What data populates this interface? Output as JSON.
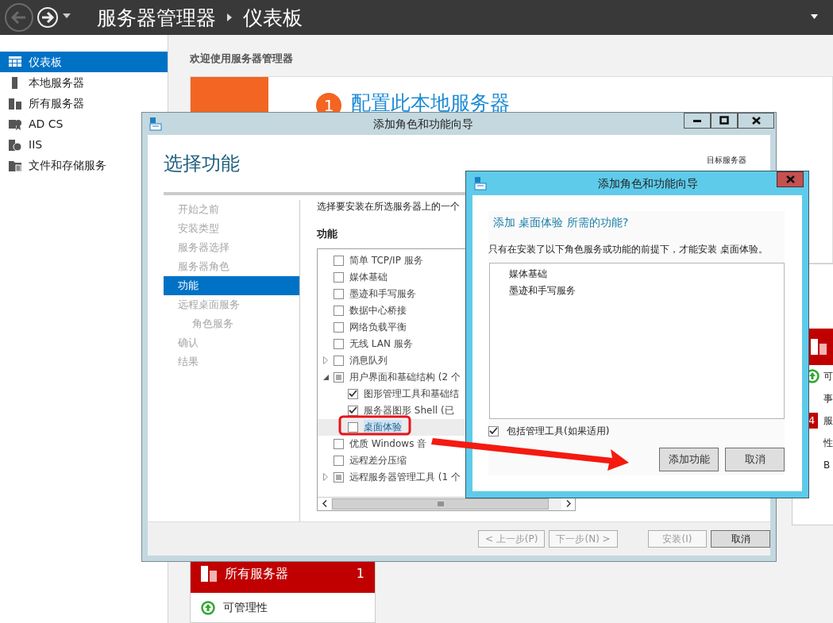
{
  "app": {
    "title": "服务器管理器",
    "page": "仪表板"
  },
  "sidebar": {
    "items": [
      {
        "label": "仪表板",
        "selected": true
      },
      {
        "label": "本地服务器",
        "selected": false
      },
      {
        "label": "所有服务器",
        "selected": false
      },
      {
        "label": "AD CS",
        "selected": false
      },
      {
        "label": "IIS",
        "selected": false
      },
      {
        "label": "文件和存储服务",
        "selected": false
      }
    ]
  },
  "dashboard": {
    "welcome": "欢迎使用服务器管理器",
    "quick_start": {
      "step": "1",
      "link": "配置此本地服务器"
    },
    "tile_main": {
      "title": "所有服务器",
      "count": "1",
      "rows": [
        {
          "label": "可管理性",
          "kind": "status"
        }
      ]
    },
    "tile_side": {
      "rows": [
        {
          "label": "可",
          "kind": "status"
        },
        {
          "label": "事",
          "kind": "plain"
        },
        {
          "label": "服",
          "kind": "badge",
          "badge": "4"
        },
        {
          "label": "性",
          "kind": "plain"
        },
        {
          "label": "B",
          "kind": "plain"
        }
      ]
    }
  },
  "wizard": {
    "title": "添加角色和功能向导",
    "heading": "选择功能",
    "target_label": "目标服务器",
    "steps": [
      {
        "label": "开始之前",
        "selected": false
      },
      {
        "label": "安装类型",
        "selected": false
      },
      {
        "label": "服务器选择",
        "selected": false
      },
      {
        "label": "服务器角色",
        "selected": false
      },
      {
        "label": "功能",
        "selected": true
      },
      {
        "label": "远程桌面服务",
        "selected": false,
        "children": [
          {
            "label": "角色服务",
            "selected": false
          }
        ]
      },
      {
        "label": "确认",
        "selected": false
      },
      {
        "label": "结果",
        "selected": false
      }
    ],
    "intro": "选择要安装在所选服务器上的一个",
    "features_label": "功能",
    "features": [
      {
        "label": "简单 TCP/IP 服务",
        "checked": false,
        "partial": false,
        "selected": false
      },
      {
        "label": "媒体基础",
        "checked": false,
        "partial": false,
        "selected": false
      },
      {
        "label": "墨迹和手写服务",
        "checked": false,
        "partial": false,
        "selected": false
      },
      {
        "label": "数据中心桥接",
        "checked": false,
        "partial": false,
        "selected": false
      },
      {
        "label": "网络负载平衡",
        "checked": false,
        "partial": false,
        "selected": false
      },
      {
        "label": "无线 LAN 服务",
        "checked": false,
        "partial": false,
        "selected": false
      },
      {
        "label": "消息队列",
        "checked": false,
        "partial": false,
        "selected": false,
        "expanded": false
      },
      {
        "label": "用户界面和基础结构 (2 个",
        "checked": false,
        "partial": true,
        "selected": false,
        "expanded": true,
        "children": [
          {
            "label": "图形管理工具和基础结",
            "checked": true,
            "partial": false,
            "selected": false
          },
          {
            "label": "服务器图形 Shell (已",
            "checked": true,
            "partial": false,
            "selected": false
          },
          {
            "label": "桌面体验",
            "checked": false,
            "partial": false,
            "selected": true
          }
        ]
      },
      {
        "label": "优质 Windows 音",
        "checked": false,
        "partial": false,
        "selected": false
      },
      {
        "label": "远程差分压缩",
        "checked": false,
        "partial": false,
        "selected": false
      },
      {
        "label": "远程服务器管理工具 (1 个",
        "checked": false,
        "partial": true,
        "selected": false,
        "expanded": false
      }
    ],
    "buttons": [
      {
        "label": "< 上一步(P)",
        "disabled": true
      },
      {
        "label": "下一步(N) >",
        "disabled": true
      },
      {
        "label": "安装(I)",
        "disabled": true
      },
      {
        "label": "取消",
        "disabled": false
      }
    ]
  },
  "dialog": {
    "title": "添加角色和功能向导",
    "heading": "添加 桌面体验 所需的功能?",
    "message": "只有在安装了以下角色服务或功能的前提下，才能安装 桌面体验。",
    "items": [
      "媒体基础",
      "墨迹和手写服务"
    ],
    "include_tools": {
      "label": "包括管理工具(如果适用)",
      "checked": true
    },
    "buttons": [
      "添加功能",
      "取消"
    ]
  }
}
